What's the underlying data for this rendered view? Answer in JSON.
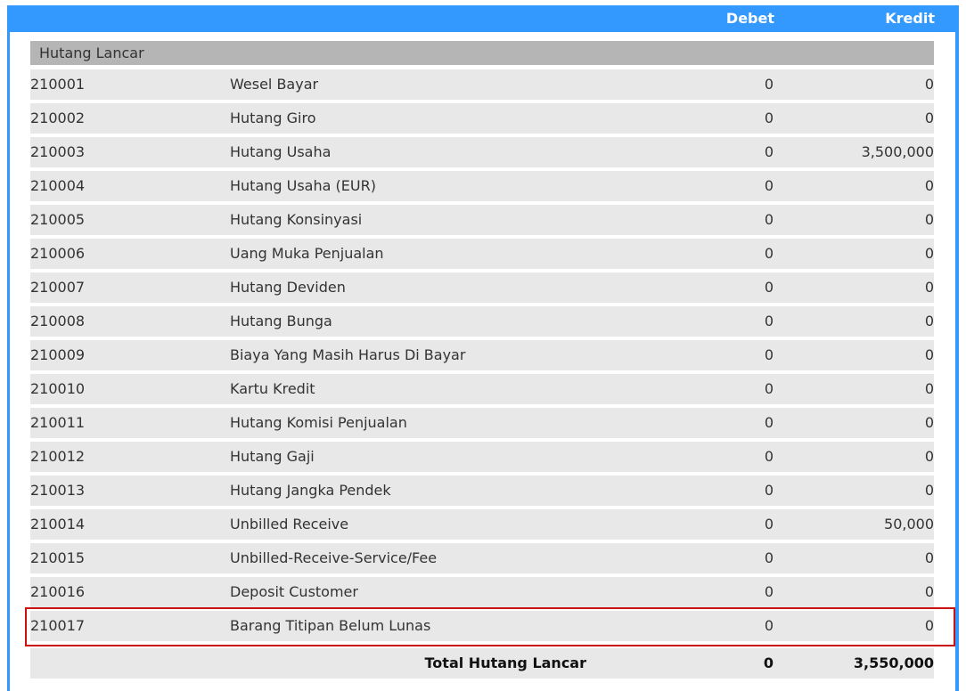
{
  "header": {
    "debet_label": "Debet",
    "kredit_label": "Kredit"
  },
  "section": {
    "title": "Hutang Lancar"
  },
  "rows": [
    {
      "code": "210001",
      "name": "Wesel Bayar",
      "debet": "0",
      "kredit": "0"
    },
    {
      "code": "210002",
      "name": "Hutang Giro",
      "debet": "0",
      "kredit": "0"
    },
    {
      "code": "210003",
      "name": "Hutang Usaha",
      "debet": "0",
      "kredit": "3,500,000"
    },
    {
      "code": "210004",
      "name": "Hutang Usaha (EUR)",
      "debet": "0",
      "kredit": "0"
    },
    {
      "code": "210005",
      "name": "Hutang Konsinyasi",
      "debet": "0",
      "kredit": "0"
    },
    {
      "code": "210006",
      "name": "Uang Muka Penjualan",
      "debet": "0",
      "kredit": "0"
    },
    {
      "code": "210007",
      "name": "Hutang Deviden",
      "debet": "0",
      "kredit": "0"
    },
    {
      "code": "210008",
      "name": "Hutang Bunga",
      "debet": "0",
      "kredit": "0"
    },
    {
      "code": "210009",
      "name": "Biaya Yang Masih Harus Di Bayar",
      "debet": "0",
      "kredit": "0"
    },
    {
      "code": "210010",
      "name": "Kartu Kredit",
      "debet": "0",
      "kredit": "0"
    },
    {
      "code": "210011",
      "name": "Hutang Komisi Penjualan",
      "debet": "0",
      "kredit": "0"
    },
    {
      "code": "210012",
      "name": "Hutang Gaji",
      "debet": "0",
      "kredit": "0"
    },
    {
      "code": "210013",
      "name": "Hutang Jangka Pendek",
      "debet": "0",
      "kredit": "0"
    },
    {
      "code": "210014",
      "name": "Unbilled Receive",
      "debet": "0",
      "kredit": "50,000"
    },
    {
      "code": "210015",
      "name": "Unbilled-Receive-Service/Fee",
      "debet": "0",
      "kredit": "0"
    },
    {
      "code": "210016",
      "name": "Deposit Customer",
      "debet": "0",
      "kredit": "0"
    },
    {
      "code": "210017",
      "name": "Barang Titipan Belum Lunas",
      "debet": "0",
      "kredit": "0"
    }
  ],
  "total": {
    "label": "Total Hutang Lancar",
    "debet": "0",
    "kredit": "3,550,000"
  },
  "highlight_color": "#cc1111",
  "header_color": "#3399ff"
}
